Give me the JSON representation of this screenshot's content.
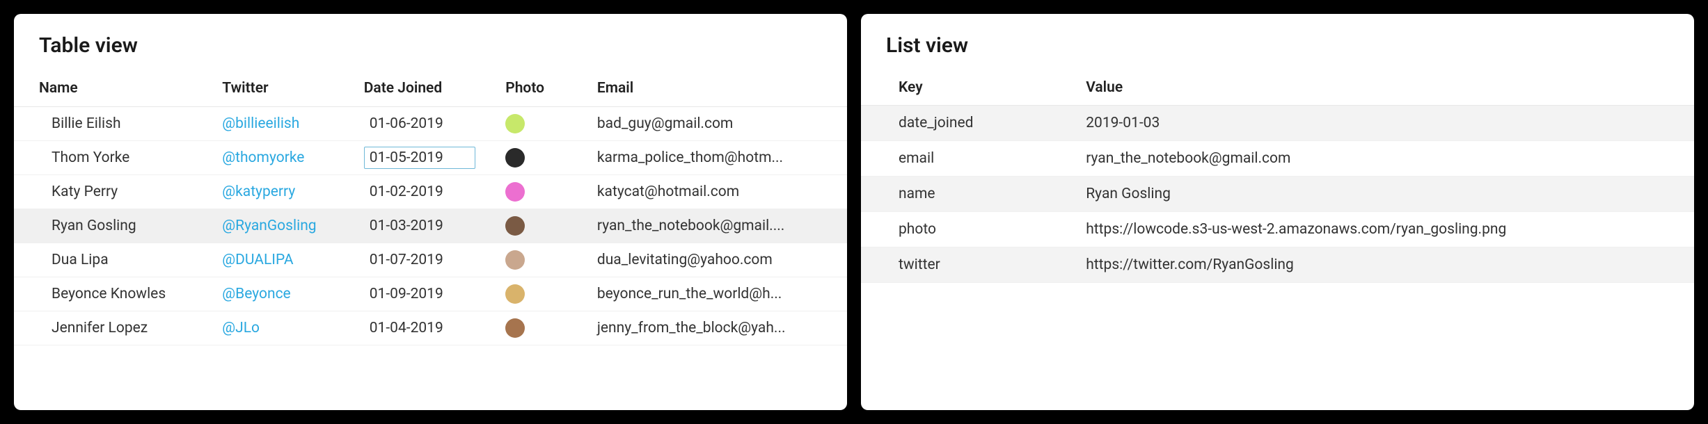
{
  "table_view": {
    "title": "Table view",
    "columns": [
      "Name",
      "Twitter",
      "Date Joined",
      "Photo",
      "Email"
    ],
    "selected_row_index": 3,
    "editing_cell": {
      "row": 1,
      "col": "date_joined"
    },
    "rows": [
      {
        "name": "Billie Eilish",
        "twitter": "@billieeilish",
        "date_joined": "01-06-2019",
        "avatar_color": "#c7e86a",
        "email": "bad_guy@gmail.com"
      },
      {
        "name": "Thom Yorke",
        "twitter": "@thomyorke",
        "date_joined": "01-05-2019",
        "avatar_color": "#2a2a2a",
        "email": "karma_police_thom@hotm..."
      },
      {
        "name": "Katy Perry",
        "twitter": "@katyperry",
        "date_joined": "01-02-2019",
        "avatar_color": "#ec6fd0",
        "email": "katycat@hotmail.com"
      },
      {
        "name": "Ryan Gosling",
        "twitter": "@RyanGosling",
        "date_joined": "01-03-2019",
        "avatar_color": "#7a5a44",
        "email": "ryan_the_notebook@gmail...."
      },
      {
        "name": "Dua Lipa",
        "twitter": "@DUALIPA",
        "date_joined": "01-07-2019",
        "avatar_color": "#c9a78e",
        "email": "dua_levitating@yahoo.com"
      },
      {
        "name": "Beyonce Knowles",
        "twitter": "@Beyonce",
        "date_joined": "01-09-2019",
        "avatar_color": "#d9b36b",
        "email": "beyonce_run_the_world@h..."
      },
      {
        "name": "Jennifer Lopez",
        "twitter": "@JLo",
        "date_joined": "01-04-2019",
        "avatar_color": "#a6744e",
        "email": "jenny_from_the_block@yah..."
      }
    ]
  },
  "list_view": {
    "title": "List view",
    "columns": [
      "Key",
      "Value"
    ],
    "rows": [
      {
        "key": "date_joined",
        "value": "2019-01-03"
      },
      {
        "key": "email",
        "value": "ryan_the_notebook@gmail.com"
      },
      {
        "key": "name",
        "value": "Ryan Gosling"
      },
      {
        "key": "photo",
        "value": "https://lowcode.s3-us-west-2.amazonaws.com/ryan_gosling.png"
      },
      {
        "key": "twitter",
        "value": "https://twitter.com/RyanGosling"
      }
    ]
  }
}
